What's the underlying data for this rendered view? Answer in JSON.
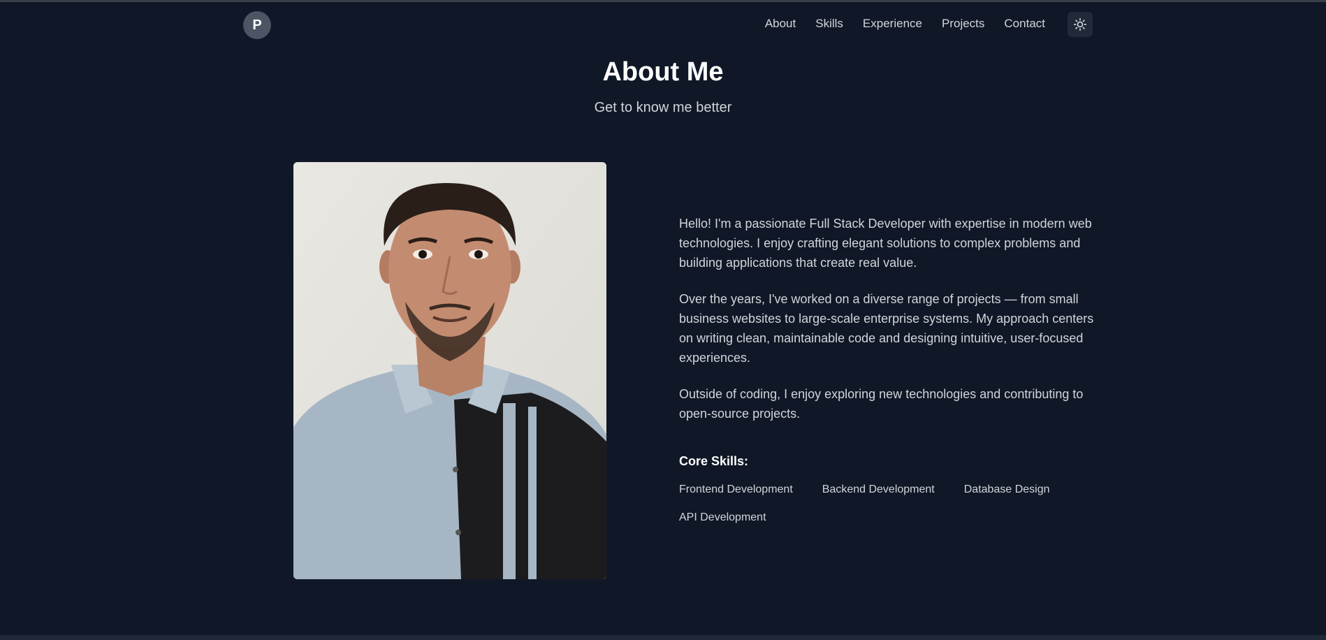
{
  "nav": {
    "logo_letter": "P",
    "links": [
      "About",
      "Skills",
      "Experience",
      "Projects",
      "Contact"
    ],
    "theme_toggle_icon": "sun-icon"
  },
  "header": {
    "title": "About Me",
    "subtitle": "Get to know me better"
  },
  "about": {
    "paragraphs": [
      "Hello! I'm a passionate Full Stack Developer with expertise in modern web technologies. I enjoy crafting elegant solutions to complex problems and building applications that create real value.",
      "Over the years, I've worked on a diverse range of projects — from small business websites to large-scale enterprise systems. My approach centers on writing clean, maintainable code and designing intuitive, user-focused experiences.",
      "Outside of coding, I enjoy exploring new technologies and contributing to open-source projects."
    ],
    "skills_heading": "Core Skills:",
    "skills": [
      "Frontend Development",
      "Backend Development",
      "Database Design",
      "API Development"
    ]
  },
  "colors": {
    "background": "#101827",
    "text": "#d1d5db",
    "heading": "#ffffff",
    "logo_bg": "#4b5563",
    "toggle_bg": "#1f2937"
  }
}
